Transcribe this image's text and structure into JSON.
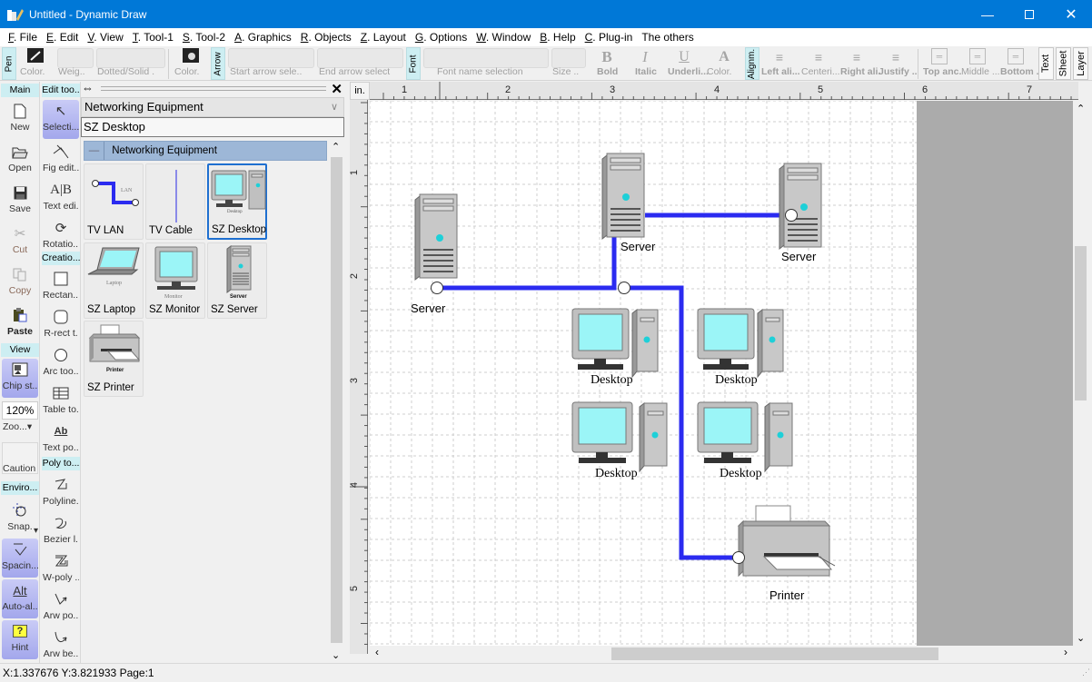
{
  "window": {
    "title": "Untitled - Dynamic Draw",
    "minimize_icon": "minimize-icon",
    "maximize_icon": "maximize-icon",
    "close_icon": "close-icon"
  },
  "menu": [
    {
      "key": "F",
      "label": ". File"
    },
    {
      "key": "E",
      "label": ". Edit"
    },
    {
      "key": "V",
      "label": ". View"
    },
    {
      "key": "T",
      "label": ". Tool-1"
    },
    {
      "key": "S",
      "label": ". Tool-2"
    },
    {
      "key": "A",
      "label": ". Graphics"
    },
    {
      "key": "R",
      "label": ". Objects"
    },
    {
      "key": "Z",
      "label": ". Layout"
    },
    {
      "key": "G",
      "label": ". Options"
    },
    {
      "key": "W",
      "label": ". Window"
    },
    {
      "key": "B",
      "label": ". Help"
    },
    {
      "key": "C",
      "label": ". Plug-in"
    },
    {
      "key": "",
      "label": "The others"
    }
  ],
  "toolbar": {
    "pen_tab": "Pen",
    "pen_color": "Color.",
    "pen_weight": "Weig..",
    "pen_style": "Dotted/Solid .",
    "fill_color": "Color.",
    "arrow_tab": "Arrow",
    "start_arrow": "Start arrow sele..",
    "end_arrow": "End arrow select",
    "font_tab": "Font",
    "font_name": "Font name selection",
    "font_size": "Size ..",
    "bold": "Bold",
    "italic": "Italic",
    "underline": "Underli...",
    "text_color": "Color.",
    "align_tab": "Alignm.",
    "left_align": "Left ali...",
    "center": "Centeri...",
    "right_align": "Right ali.",
    "justify": "Justify ..",
    "top_anchor": "Top anc.",
    "middle": "Middle ...",
    "bottom": "Bottom ..",
    "text_tab": "Text",
    "sheet_tab": "Sheet",
    "layer_tab": "Layer"
  },
  "left_toolbar": {
    "main_header": "Main",
    "new": "New",
    "open": "Open",
    "save": "Save",
    "cut": "Cut",
    "copy": "Copy",
    "paste": "Paste",
    "view_header": "View",
    "chip": "Chip st..",
    "zoom_value": "120%",
    "zoom_label": "Zoo...",
    "caution": "Caution",
    "env_header": "Enviro...",
    "snap": "Snap.",
    "spacing": "Spacin...",
    "auto_align_icon_text": "Alt",
    "auto_align": "Auto-al..",
    "hint_icon_text": "?",
    "hint": "Hint"
  },
  "edit_toolbar": {
    "edit_header": "Edit too..",
    "selection": "Selecti...",
    "fig_edit": "Fig edit..",
    "text_edit": "Text edi.",
    "rotation": "Rotatio...",
    "creation_header": "Creatio...",
    "rectangle": "Rectan...",
    "rrect": "R-rect t.",
    "arc": "Arc too..",
    "table": "Table to.",
    "text_pos": "Text po...",
    "poly_header": "Poly to...",
    "polyline": "Polyline..",
    "bezier": "Bezier l.",
    "wpoly": "W-poly ..",
    "arw_poly": "Arw po..",
    "arw_bez": "Arw be.."
  },
  "library_panel": {
    "category": "Networking Equipment",
    "selected_item": "SZ Desktop",
    "group_label": "Networking Equipment",
    "items": [
      {
        "label": "TV LAN",
        "caption": "LAN"
      },
      {
        "label": "TV Cable",
        "caption": ""
      },
      {
        "label": "SZ Desktop",
        "caption": "Desktop"
      },
      {
        "label": "SZ Laptop",
        "caption": "Laptop"
      },
      {
        "label": "SZ Monitor",
        "caption": "Monitor"
      },
      {
        "label": "SZ Server",
        "caption": "Server"
      },
      {
        "label": "SZ Printer",
        "caption": "Printer"
      }
    ]
  },
  "rulers": {
    "unit": "in.",
    "h_ticks": [
      "1",
      "2",
      "3",
      "4",
      "5",
      "6",
      "7"
    ],
    "v_ticks": [
      "1",
      "2",
      "3",
      "4",
      "5"
    ]
  },
  "diagram": {
    "link_color": "#2b2bf0",
    "screen_color": "#9bf5f7",
    "nodes": {
      "server_left": "Server",
      "server_center": "Server",
      "server_right": "Server",
      "desktop_1": "Desktop",
      "desktop_2": "Desktop",
      "desktop_3": "Desktop",
      "desktop_4": "Desktop",
      "printer": "Printer"
    }
  },
  "status": {
    "text": "X:1.337676 Y:3.821933 Page:1"
  }
}
